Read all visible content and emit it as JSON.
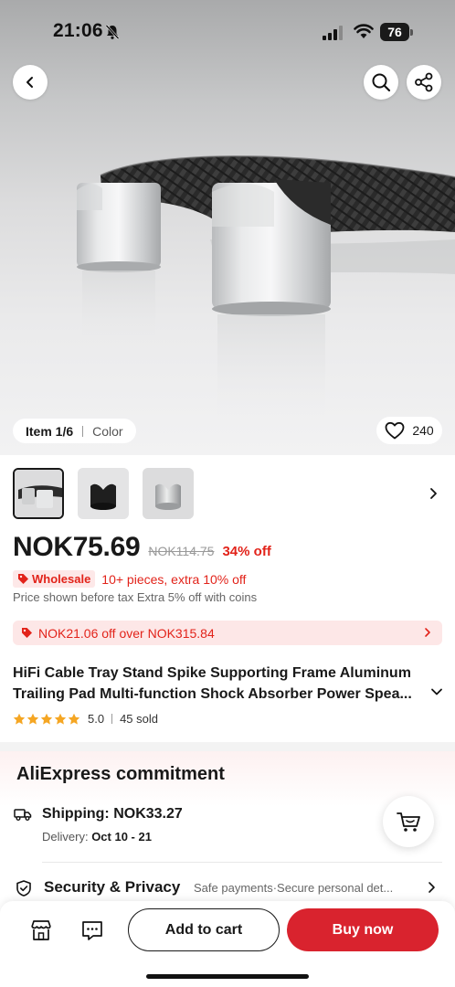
{
  "status_bar": {
    "time": "21:06",
    "battery": "76"
  },
  "gallery": {
    "item_label": "Item 1/6",
    "color_label": "Color",
    "favorites_count": "240"
  },
  "price": {
    "current": "NOK75.69",
    "original": "NOK114.75",
    "discount": "34% off"
  },
  "wholesale": {
    "badge": "Wholesale",
    "text": "10+ pieces, extra 10% off"
  },
  "tax_note": "Price shown before tax Extra 5% off with coins",
  "coupon": {
    "text": "NOK21.06 off over NOK315.84"
  },
  "product": {
    "title": "HiFi Cable Tray Stand Spike Supporting Frame Aluminum Trailing Pad Multi-function Shock Absorber Power Spea...",
    "rating": "5.0",
    "sold": "45 sold",
    "stars": 5
  },
  "commitment": {
    "title": "AliExpress commitment",
    "shipping_label": "Shipping: NOK33.27",
    "delivery_prefix": "Delivery: ",
    "delivery_dates": "Oct 10 - 21",
    "security_label": "Security & Privacy",
    "security_detail": "Safe payments·Secure personal det..."
  },
  "actions": {
    "add_to_cart": "Add to cart",
    "buy_now": "Buy now"
  },
  "colors": {
    "accent_red": "#e2231a",
    "buy_button": "#d9232e",
    "coupon_bg": "#fde7e7"
  },
  "icons": [
    "back-icon",
    "search-icon",
    "share-icon",
    "heart-icon",
    "chevron-right-icon",
    "chevron-down-icon",
    "tag-icon",
    "truck-icon",
    "shield-icon",
    "cart-icon",
    "store-icon",
    "message-icon",
    "bell-off-icon",
    "signal-icon",
    "wifi-icon"
  ]
}
